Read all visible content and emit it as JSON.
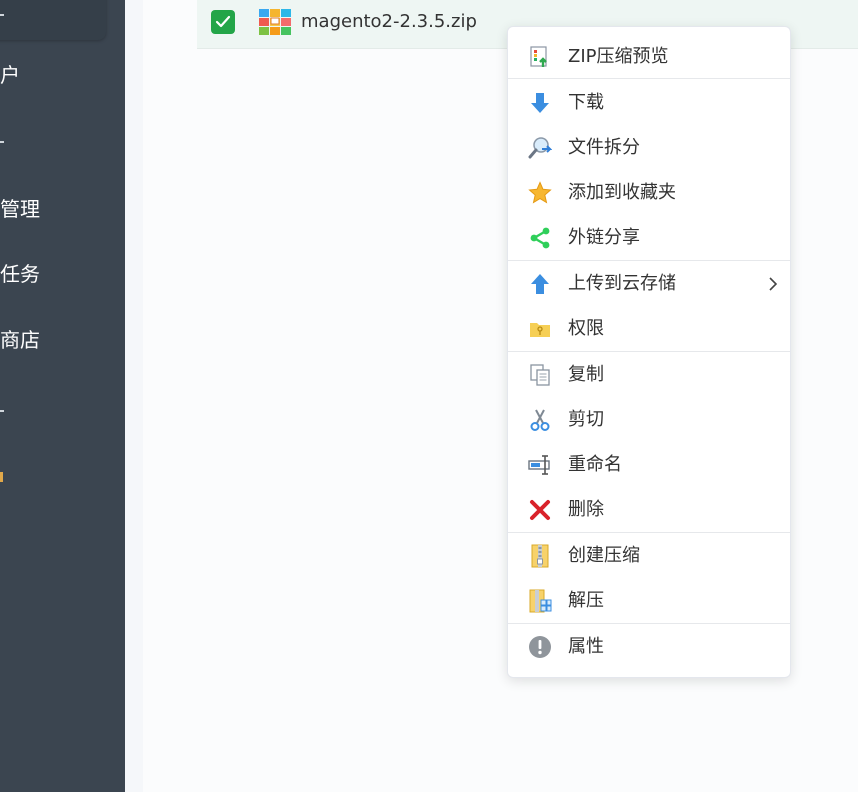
{
  "sidebar": {
    "items": [
      {
        "label": "户"
      },
      {
        "label": "管理"
      },
      {
        "label": "任务"
      },
      {
        "label": "商店"
      }
    ]
  },
  "file": {
    "name": "magento2-2.3.5.zip",
    "checked": true
  },
  "context_menu": {
    "items": [
      {
        "label": "ZIP压缩预览",
        "icon": "zip-preview-icon"
      },
      {
        "label": "下载",
        "icon": "download-icon"
      },
      {
        "label": "文件拆分",
        "icon": "split-icon"
      },
      {
        "label": "添加到收藏夹",
        "icon": "star-icon"
      },
      {
        "label": "外链分享",
        "icon": "share-icon"
      },
      {
        "label": "上传到云存储",
        "icon": "upload-icon",
        "has_submenu": true
      },
      {
        "label": "权限",
        "icon": "permission-folder-icon"
      },
      {
        "label": "复制",
        "icon": "copy-icon"
      },
      {
        "label": "剪切",
        "icon": "scissors-icon"
      },
      {
        "label": "重命名",
        "icon": "rename-icon"
      },
      {
        "label": "删除",
        "icon": "delete-icon"
      },
      {
        "label": "创建压缩",
        "icon": "compress-icon"
      },
      {
        "label": "解压",
        "icon": "extract-icon"
      },
      {
        "label": "属性",
        "icon": "info-icon"
      }
    ]
  },
  "colors": {
    "sidebar": "#3b4550",
    "checkbox": "#23a548",
    "row_highlight": "#eef6f3"
  }
}
